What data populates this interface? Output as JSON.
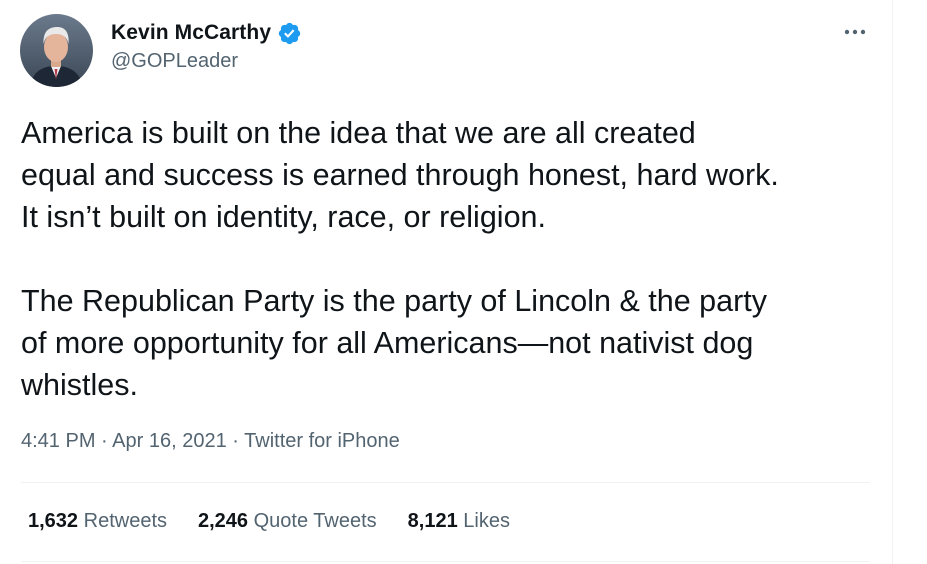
{
  "author": {
    "display_name": "Kevin McCarthy",
    "handle": "@GOPLeader",
    "verified": true,
    "avatar_icon": "profile-photo"
  },
  "more_icon": "more-horizontal-icon",
  "tweet": {
    "text": "America is built on the idea that we are all created\nequal and success is earned through honest, hard work.\nIt isn’t built on identity, race, or religion.\n\nThe Republican Party is the party of Lincoln & the party\nof more opportunity for all Americans—not nativist dog\nwhistles.",
    "time": "4:41 PM",
    "date": "Apr 16, 2021",
    "source": "Twitter for iPhone",
    "separator": "·"
  },
  "stats": {
    "retweets": {
      "count": "1,632",
      "label": "Retweets"
    },
    "quote_tweets": {
      "count": "2,246",
      "label": "Quote Tweets"
    },
    "likes": {
      "count": "8,121",
      "label": "Likes"
    }
  },
  "colors": {
    "text_primary": "#0f1419",
    "text_secondary": "#536471",
    "verified_blue": "#1d9bf0",
    "divider": "#eff3f4"
  }
}
